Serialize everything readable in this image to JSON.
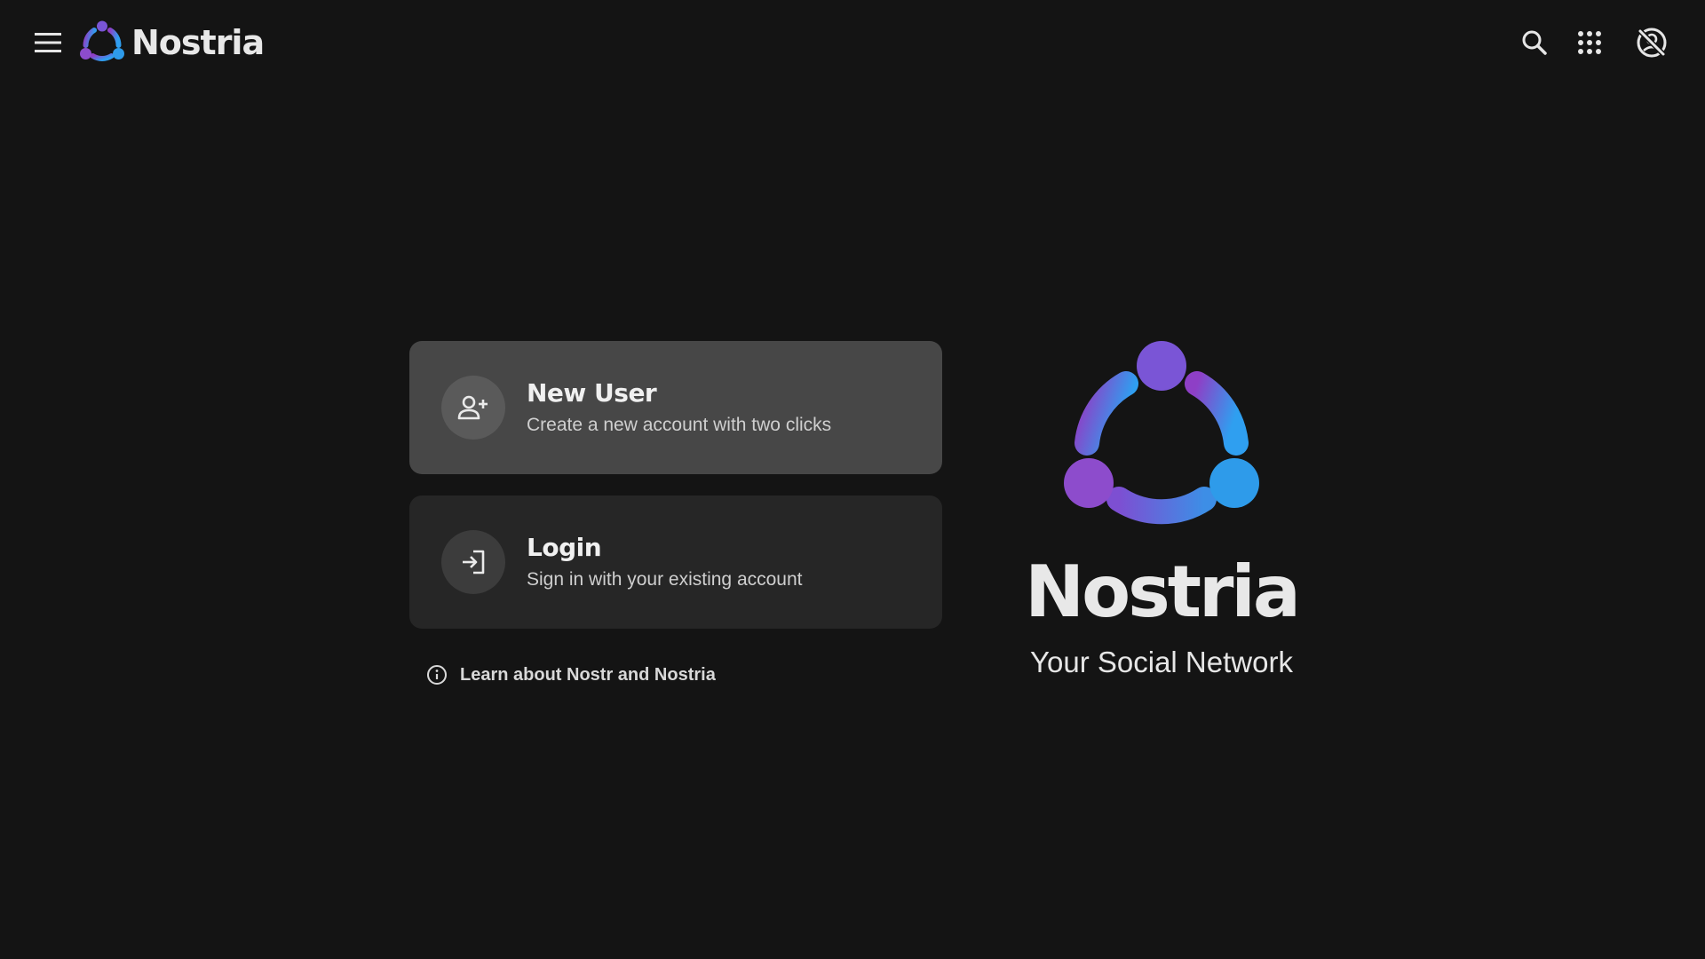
{
  "app": {
    "name": "Nostria"
  },
  "toolbar": {
    "menu_icon": "menu-icon",
    "search_icon": "search-icon",
    "apps_icon": "apps-grid-icon",
    "account_icon": "account-off-icon"
  },
  "cards": {
    "new_user": {
      "title": "New User",
      "subtitle": "Create a new account with two clicks",
      "icon": "person-add-icon"
    },
    "login": {
      "title": "Login",
      "subtitle": "Sign in with your existing account",
      "icon": "login-icon"
    }
  },
  "learn_link": {
    "label": "Learn about Nostr and Nostria",
    "icon": "info-icon"
  },
  "hero": {
    "title": "Nostria",
    "tagline": "Your Social Network"
  },
  "colors": {
    "background": "#141414",
    "card_primary": "#474747",
    "card_secondary": "#262626",
    "logo_purple": "#8e44c9",
    "logo_blue": "#2e9bea"
  }
}
